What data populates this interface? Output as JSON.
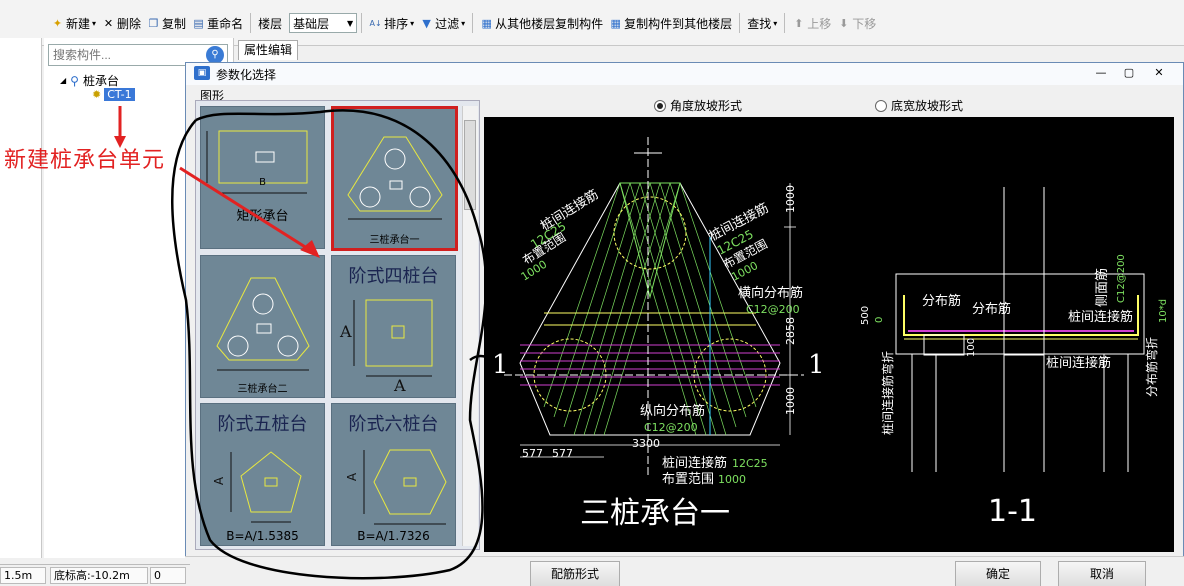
{
  "toolbar": {
    "new_label": "新建",
    "delete_label": "删除",
    "copy_label": "复制",
    "rename_label": "重命名",
    "floor_label": "楼层",
    "floor_value": "基础层",
    "sort_label": "排序",
    "filter_label": "过滤",
    "copy_from_label": "从其他楼层复制构件",
    "copy_to_label": "复制构件到其他楼层",
    "find_label": "查找",
    "move_up_label": "上移",
    "move_down_label": "下移"
  },
  "search": {
    "placeholder": "搜索构件..."
  },
  "props_tab": "属性编辑",
  "tree": {
    "root_label": "桩承台",
    "child_label": "CT-1"
  },
  "annotation": "新建桩承台单元",
  "dialog": {
    "title": "参数化选择",
    "group_label": "图形",
    "radio_angle": "角度放坡形式",
    "radio_width": "底宽放坡形式",
    "rebar_button": "配筋形式",
    "ok_button": "确定",
    "cancel_button": "取消"
  },
  "thumbnails": [
    {
      "label": "矩形承台",
      "big": "",
      "dim1": "B",
      "dim2": ""
    },
    {
      "label": "三桩承台一",
      "big": "",
      "dim1": "",
      "dim2": ""
    },
    {
      "label": "三桩承台二",
      "big": "",
      "dim1": "",
      "dim2": ""
    },
    {
      "label": "",
      "big": "阶式四桩台",
      "dim1": "A",
      "dim2": "A"
    },
    {
      "label": "B=A/1.5385",
      "big": "阶式五桩台",
      "dim1": "A",
      "dim2": ""
    },
    {
      "label": "B=A/1.7326",
      "big": "阶式六桩台",
      "dim1": "A",
      "dim2": ""
    }
  ],
  "drawing": {
    "main_title": "三桩承台一",
    "section_title": "1-1",
    "section_mark": "1",
    "rebar_between_piles": "桩间连接筋",
    "rebar_between_piles_spec": "12C25",
    "layout_range": "布置范围",
    "layout_range_value": "1000",
    "transverse_dist": "横向分布筋",
    "transverse_spec": "C12@200",
    "longitudinal_dist": "纵向分布筋",
    "longitudinal_spec": "C12@200",
    "dim_2858": "2858",
    "dim_1000": "1000",
    "dim_3300": "3300",
    "dim_577": "577",
    "dist_bar": "分布筋",
    "side_bar": "侧面筋",
    "side_bar_spec": "C12@200",
    "dim_500": "500",
    "dim_0": "0",
    "dim_100": "100",
    "dim_10d": "10*d",
    "bend_label": "桩间连接筋弯折",
    "dist_bend_label": "分布筋弯折"
  },
  "status": {
    "left_value": "1.5m",
    "elev_label": "底标高:-10.2m",
    "zero": "0"
  }
}
